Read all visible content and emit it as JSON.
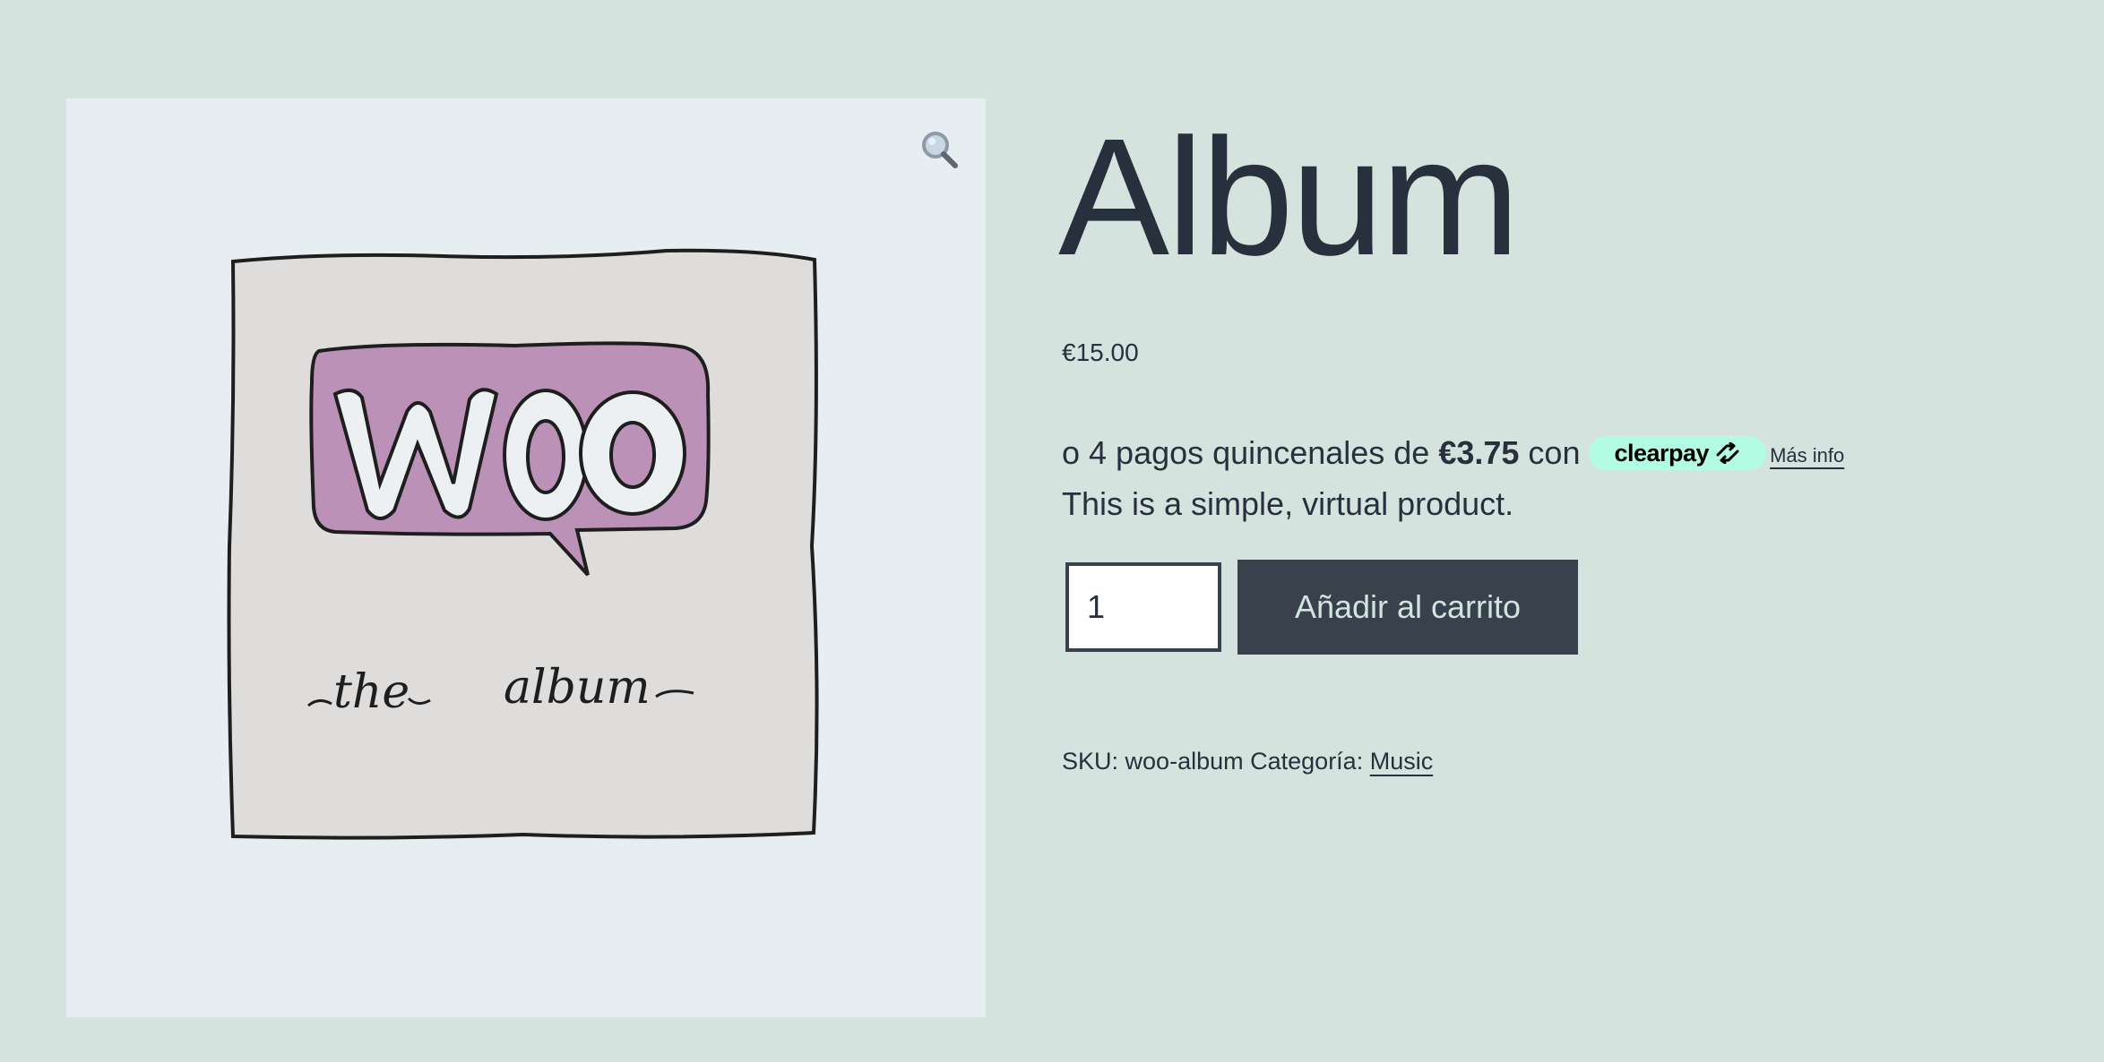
{
  "product": {
    "title": "Album",
    "price": "€15.00",
    "description": "This is a simple, virtual product.",
    "sku_label": "SKU:",
    "sku": "woo-album",
    "category_label": "Categoría:",
    "category": "Music"
  },
  "image": {
    "badge_text": "WOO",
    "caption_left": "the",
    "caption_right": "album",
    "zoom_icon": "magnifier-icon"
  },
  "clearpay": {
    "prefix": "o 4 pagos quincenales de",
    "amount": "€3.75",
    "con": "con",
    "brand": "clearpay",
    "more_info": "Más info",
    "badge_color": "#b2fce4"
  },
  "cart": {
    "quantity": "1",
    "add_label": "Añadir al carrito"
  },
  "colors": {
    "background": "#d5e3de",
    "image_panel": "#e6eef1",
    "text": "#28303d",
    "button": "#39414d",
    "badge_purple": "#bb91b8"
  }
}
